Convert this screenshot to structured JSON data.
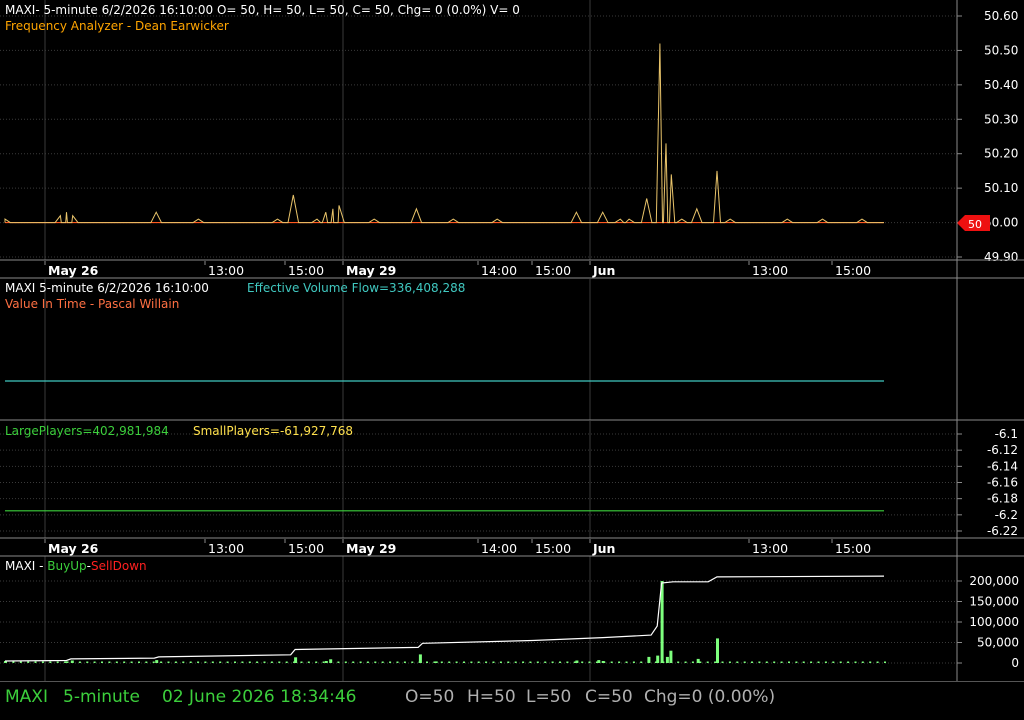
{
  "colors": {
    "bg": "#000000",
    "grid": "#3a3a3a",
    "border": "#8a8a8a",
    "white": "#ffffff",
    "orange": "#ffa500",
    "price_line": "#e9c46a",
    "base_line": "#ff5a1f",
    "cyan": "#40c8c0",
    "green": "#3ccf3c",
    "yellow": "#ffe14d",
    "red": "#ff2020",
    "bar_green": "#7dff7d",
    "value_marker": "#ee1010"
  },
  "panel1": {
    "header": "MAXI- 5-minute 6/2/2026 16:10:00 O= 50, H= 50, L= 50, C= 50, Chg= 0 (0.0%) V= 0",
    "subtitle": "Frequency Analyzer - Dean Earwicker",
    "last_value_label": "50"
  },
  "panel2": {
    "header_prefix": "MAXI 5-minute  6/2/2026 16:10:00",
    "header_value": "Effective Volume Flow=336,408,288",
    "subtitle": "Value In Time - Pascal Willain"
  },
  "panel3": {
    "large_label": "LargePlayers=402,981,984",
    "small_label": "SmallPlayers=-61,927,768"
  },
  "panel4": {
    "prefix": "MAXI - ",
    "buy_label": "BuyUp",
    "dash": "-",
    "sell_label": "SellDown"
  },
  "date_axis": {
    "labels": [
      "May 26",
      "13:00",
      "15:00",
      "May 29",
      "14:00",
      "15:00",
      "Jun",
      "13:00",
      "15:00"
    ],
    "bold": [
      true,
      false,
      false,
      true,
      false,
      false,
      true,
      false,
      false
    ]
  },
  "status_bar": {
    "symbol": "MAXI",
    "interval": "5-minute",
    "datetime": "02 June 2026 18:34:46",
    "open": "O=50",
    "high": "H=50",
    "low": "L=50",
    "close": "C=50",
    "change": "Chg=0 (0.00%)"
  },
  "chart_data": [
    {
      "type": "line",
      "name": "price",
      "y_ticks": [
        "50.60",
        "50.50",
        "50.40",
        "50.30",
        "50.20",
        "50.10",
        "50.00",
        "49.90"
      ],
      "ylim": [
        49.9,
        50.6
      ],
      "series": [
        {
          "values": [
            50.01,
            50.0,
            50.0,
            50.0,
            50.0,
            50.0,
            50.0,
            50.0,
            50.0,
            50.0,
            50.0,
            50.0,
            50.0,
            50.0,
            50.0,
            50.0,
            50.0,
            50.0,
            50.0,
            50.0,
            50.0,
            50.02,
            50.0,
            50.03,
            50.0,
            50.02,
            50.0,
            50.0,
            50.01,
            50.0,
            50.0,
            50.0,
            50.0,
            50.0,
            50.0,
            50.0,
            50.0,
            50.0,
            50.0,
            50.0,
            50.0,
            50.0,
            50.03,
            50.0,
            50.0,
            50.0,
            50.0,
            50.0,
            50.0,
            50.0,
            50.0,
            50.0,
            50.0,
            50.0,
            50.0,
            50.0,
            50.0,
            50.0,
            50.0,
            50.0,
            50.0,
            50.0,
            50.0,
            50.0,
            50.0,
            50.0,
            50.0,
            50.0,
            50.0,
            50.0,
            50.0,
            50.0,
            50.0,
            50.0,
            50.0,
            50.0,
            50.0,
            50.0,
            50.0,
            50.0,
            50.0,
            50.0,
            50.0,
            50.0,
            50.0,
            50.0,
            50.08,
            50.0,
            50.0,
            50.0,
            50.0,
            50.0,
            50.0,
            50.0,
            50.02,
            50.0,
            50.05,
            50.0,
            50.04,
            50.0,
            50.0,
            50.0,
            50.0,
            50.0,
            50.0,
            50.0,
            50.0,
            50.0,
            50.0,
            50.0,
            50.0,
            50.0,
            50.0,
            50.0,
            50.0,
            50.0,
            50.0,
            50.04,
            50.0,
            50.0,
            50.0,
            50.0,
            50.0,
            50.0,
            50.0,
            50.0,
            50.0,
            50.0,
            50.0,
            50.0,
            50.0,
            50.0,
            50.0,
            50.0,
            50.0,
            50.0,
            50.0,
            50.0,
            50.0,
            50.0,
            50.0,
            50.0,
            50.0,
            50.0,
            50.0,
            50.0,
            50.0,
            50.0,
            50.0,
            50.0,
            50.0,
            50.0,
            50.0,
            50.0,
            50.0,
            50.0,
            50.0,
            50.0,
            50.0,
            50.0,
            50.0,
            50.0,
            50.0,
            50.0,
            50.0,
            50.0,
            50.0,
            50.0,
            50.0,
            50.0,
            50.0,
            50.0,
            50.0,
            50.0,
            50.0,
            50.0,
            50.0,
            50.0,
            50.0,
            50.0,
            50.0,
            50.0,
            50.0,
            50.0,
            50.03,
            50.0,
            50.0,
            50.0,
            50.0,
            50.0,
            50.0,
            50.0,
            50.0,
            50.0,
            50.0,
            50.0,
            50.0,
            50.0,
            50.0,
            50.0,
            50.0,
            50.0,
            50.0,
            50.0,
            50.0,
            50.0,
            50.0,
            50.0,
            50.0,
            50.0,
            50.0,
            50.0,
            50.0,
            50.0,
            50.0,
            50.0,
            50.0,
            50.0,
            50.0,
            50.0,
            50.0,
            50.0,
            50.0,
            50.0,
            50.0,
            50.0,
            50.0,
            50.0,
            50.0,
            50.0,
            50.0,
            50.0,
            50.0,
            50.0,
            50.0,
            50.0,
            50.0,
            50.0,
            50.0,
            50.0,
            50.0,
            50.0,
            50.0,
            50.0,
            50.0,
            50.0,
            50.0,
            50.0,
            50.0,
            50.0,
            50.0,
            50.0,
            50.0,
            50.0,
            50.0,
            50.0,
            50.0,
            50.0,
            50.0,
            50.0,
            50.0,
            50.0,
            50.0,
            50.0,
            50.0,
            50.0,
            50.0,
            50.0,
            50.0,
            50.0,
            50.0,
            50.0,
            50.0,
            50.0,
            50.0,
            50.0,
            50.0,
            50.0,
            50.0,
            50.0,
            50.0,
            50.0,
            50.0,
            50.0,
            50.0,
            50.0,
            50.0,
            50.0,
            50.0,
            50.0,
            50.0,
            50.0,
            50.0,
            50.0,
            50.0,
            50.0,
            50.0,
            50.0,
            50.0,
            50.0,
            50.0,
            50.0,
            50.0,
            50.0,
            50.0,
            50.0,
            50.0,
            50.0,
            50.0,
            50.0,
            50.0,
            50.0,
            50.0,
            50.0,
            50.0,
            50.0,
            50.0,
            50.0,
            50.0,
            50.0,
            50.0,
            50.0,
            50.0,
            50.0,
            50.0,
            50.0,
            50.0,
            50.0,
            50.0,
            50.0,
            50.0,
            50.0,
            50.0,
            50.0,
            50.0,
            50.0,
            50.0,
            50.0,
            50.0,
            50.0,
            50.0,
            50.0,
            50.0,
            50.0,
            50.0,
            50.0,
            50.0,
            50.0,
            50.0,
            50.0,
            50.0,
            50.0,
            50.0,
            50.0,
            50.0,
            50.0,
            50.0,
            50.0,
            50.0,
            50.0,
            50.0,
            50.0,
            50.0,
            50.0,
            50.0,
            50.0,
            50.0,
            50.0,
            50.0,
            50.0,
            50.0,
            50.0,
            50.0,
            50.0,
            50.0,
            50.0,
            50.0,
            50.0,
            50.0,
            50.0,
            50.0,
            50.0,
            50.0,
            50.0,
            50.0,
            50.0,
            50.0,
            50.0,
            50.0,
            50.0,
            50.0,
            50.0,
            50.0,
            50.0,
            50.0,
            50.0,
            50.0,
            50.0,
            50.0,
            50.0,
            50.0,
            50.0,
            50.0,
            50.0,
            50.0,
            50.0,
            50.0,
            50.0,
            50.0,
            50.0,
            50.0,
            50.0,
            50.0,
            50.0,
            50.0,
            50.0,
            50.0,
            50.0,
            50.0,
            50.0,
            50.0,
            50.0,
            50.0,
            50.0,
            50.0,
            50.0,
            50.0,
            50.0,
            50.0,
            50.0,
            50.0,
            50.0,
            50.0,
            50.0,
            50.0,
            50.0,
            50.0,
            50.0,
            50.0,
            50.0,
            50.0,
            50.0,
            50.0,
            50.0,
            50.0,
            50.0,
            50.0,
            50.0,
            50.0,
            50.0,
            50.0,
            50.0,
            50.0,
            50.0,
            50.0,
            50.0,
            50.0,
            50.0,
            50.0,
            50.0,
            50.0,
            50.0,
            50.0,
            50.0,
            50.0,
            50.0,
            50.0,
            50.0,
            50.0,
            50.0,
            50.0,
            50.0,
            50.0,
            50.0,
            50.0,
            50.0,
            50.0,
            50.0,
            50.0,
            50.0,
            50.0,
            50.0,
            50.0,
            50.0,
            50.0,
            50.0,
            50.0,
            50.0,
            50.0,
            50.0,
            50.0,
            50.0,
            50.0,
            50.0,
            50.0,
            50.0,
            50.0,
            50.0,
            50.0,
            50.0,
            50.0,
            50.0,
            50.0,
            50.0,
            50.0,
            50.0,
            50.0,
            50.0,
            50.0,
            50.0,
            50.0,
            50.0,
            50.0,
            50.0,
            50.0,
            50.0,
            50.0,
            50.0,
            50.0,
            50.0,
            50.0,
            50.0,
            50.0,
            50.0,
            50.0,
            50.0,
            50.0,
            50.0,
            50.0,
            50.0,
            50.0,
            50.0,
            50.0,
            50.0,
            50.0,
            50.0,
            50.0,
            50.0,
            50.0,
            50.0,
            50.0,
            50.0,
            50.0,
            50.0,
            50.0,
            50.0,
            50.0,
            50.0,
            50.0,
            50.0,
            50.0,
            50.0,
            50.0,
            50.0,
            50.0,
            50.0,
            50.0,
            50.0,
            50.0,
            50.0,
            50.0,
            50.0,
            50.0,
            50.0,
            50.0,
            50.0,
            50.0,
            50.0,
            50.0,
            50.0,
            50.0,
            50.0,
            50.0,
            50.0,
            50.0,
            50.0,
            50.0,
            50.0,
            50.0,
            50.0,
            50.0,
            50.0,
            50.0,
            50.0,
            50.0,
            50.0,
            50.0,
            50.0,
            50.0,
            50.0,
            50.0,
            50.0,
            50.0,
            50.0,
            50.0
          ]
        }
      ],
      "spikes": [
        {
          "t": 0.0,
          "v": 50.01
        },
        {
          "t": 0.063,
          "v": 50.02
        },
        {
          "t": 0.07,
          "v": 50.03
        },
        {
          "t": 0.077,
          "v": 50.02
        },
        {
          "t": 0.172,
          "v": 50.03
        },
        {
          "t": 0.22,
          "v": 50.01
        },
        {
          "t": 0.31,
          "v": 50.01
        },
        {
          "t": 0.328,
          "v": 50.08
        },
        {
          "t": 0.355,
          "v": 50.01
        },
        {
          "t": 0.365,
          "v": 50.03
        },
        {
          "t": 0.373,
          "v": 50.04
        },
        {
          "t": 0.38,
          "v": 50.05
        },
        {
          "t": 0.42,
          "v": 50.01
        },
        {
          "t": 0.468,
          "v": 50.04
        },
        {
          "t": 0.51,
          "v": 50.01
        },
        {
          "t": 0.56,
          "v": 50.01
        },
        {
          "t": 0.65,
          "v": 50.03
        },
        {
          "t": 0.68,
          "v": 50.03
        },
        {
          "t": 0.7,
          "v": 50.01
        },
        {
          "t": 0.71,
          "v": 50.01
        },
        {
          "t": 0.73,
          "v": 50.07
        },
        {
          "t": 0.745,
          "v": 50.52
        },
        {
          "t": 0.752,
          "v": 50.23
        },
        {
          "t": 0.758,
          "v": 50.14
        },
        {
          "t": 0.77,
          "v": 50.01
        },
        {
          "t": 0.787,
          "v": 50.04
        },
        {
          "t": 0.81,
          "v": 50.15
        },
        {
          "t": 0.825,
          "v": 50.01
        },
        {
          "t": 0.89,
          "v": 50.01
        },
        {
          "t": 0.93,
          "v": 50.01
        },
        {
          "t": 0.975,
          "v": 50.01
        }
      ]
    },
    {
      "type": "line",
      "name": "Effective Volume Flow",
      "series": [
        {
          "name": "Effective Volume Flow",
          "values": [
            336408288,
            336408288
          ]
        }
      ]
    },
    {
      "type": "line",
      "name": "Large/Small Players",
      "y_ticks": [
        "-6.1",
        "-6.12",
        "-6.14",
        "-6.16",
        "-6.18",
        "-6.2",
        "-6.22"
      ],
      "ylim": [
        -6.225,
        -6.095
      ],
      "series": [
        {
          "name": "LargePlayers",
          "values": [
            -6.195,
            -6.195
          ]
        }
      ]
    },
    {
      "type": "bar",
      "name": "BuyUp-SellDown",
      "y_ticks": [
        "200,000",
        "150,000",
        "100,000",
        "50,000",
        "0"
      ],
      "ylim": [
        0,
        220000
      ],
      "cumulative": [
        {
          "t": 0.0,
          "v": 5000
        },
        {
          "t": 0.07,
          "v": 6000
        },
        {
          "t": 0.075,
          "v": 10000
        },
        {
          "t": 0.17,
          "v": 12000
        },
        {
          "t": 0.175,
          "v": 15000
        },
        {
          "t": 0.325,
          "v": 20000
        },
        {
          "t": 0.33,
          "v": 33000
        },
        {
          "t": 0.47,
          "v": 38000
        },
        {
          "t": 0.475,
          "v": 48000
        },
        {
          "t": 0.6,
          "v": 55000
        },
        {
          "t": 0.68,
          "v": 62000
        },
        {
          "t": 0.735,
          "v": 68000
        },
        {
          "t": 0.742,
          "v": 90000
        },
        {
          "t": 0.747,
          "v": 195000
        },
        {
          "t": 0.76,
          "v": 198000
        },
        {
          "t": 0.8,
          "v": 198000
        },
        {
          "t": 0.81,
          "v": 210000
        },
        {
          "t": 1.0,
          "v": 212000
        }
      ],
      "bars": [
        {
          "t": 0.0,
          "v": 5000
        },
        {
          "t": 0.07,
          "v": 4000
        },
        {
          "t": 0.076,
          "v": 6000
        },
        {
          "t": 0.172,
          "v": 7000
        },
        {
          "t": 0.33,
          "v": 14000
        },
        {
          "t": 0.365,
          "v": 5000
        },
        {
          "t": 0.37,
          "v": 9000
        },
        {
          "t": 0.472,
          "v": 21000
        },
        {
          "t": 0.49,
          "v": 4000
        },
        {
          "t": 0.65,
          "v": 6000
        },
        {
          "t": 0.675,
          "v": 7000
        },
        {
          "t": 0.68,
          "v": 5000
        },
        {
          "t": 0.732,
          "v": 15000
        },
        {
          "t": 0.742,
          "v": 18000
        },
        {
          "t": 0.747,
          "v": 200000
        },
        {
          "t": 0.753,
          "v": 15000
        },
        {
          "t": 0.757,
          "v": 30000
        },
        {
          "t": 0.788,
          "v": 10000
        },
        {
          "t": 0.81,
          "v": 60000
        }
      ]
    }
  ]
}
